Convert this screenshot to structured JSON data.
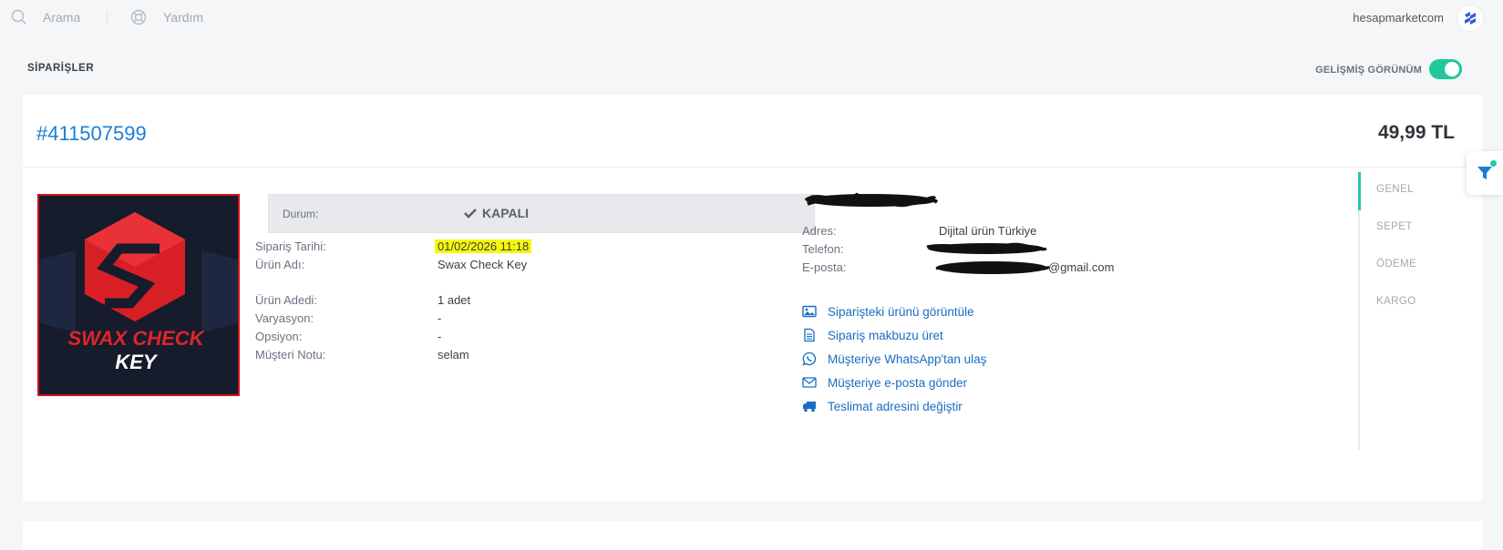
{
  "topbar": {
    "search_label": "Arama",
    "help_label": "Yardım",
    "username": "hesapmarketcom",
    "logo_icon": "store-logo-icon"
  },
  "page": {
    "title": "SİPARİŞLER",
    "advanced_view_label": "GELİŞMİŞ GÖRÜNÜM",
    "advanced_view_on": true
  },
  "order": {
    "number": "#411507599",
    "total": "49,99 TL",
    "product_image_text_line1": "SWAX CHECK",
    "product_image_text_line2": "KEY",
    "status_label": "Durum:",
    "status_value": "KAPALI",
    "fields": [
      {
        "label": "Sipariş Tarihi:",
        "value": "01/02/2026 11:18"
      },
      {
        "label": "Ürün Adı:",
        "value": "Swax Check Key"
      },
      {
        "label": "Ürün Adedi:",
        "value": "1 adet"
      },
      {
        "label": "Varyasyon:",
        "value": "-"
      },
      {
        "label": "Opsiyon:",
        "value": "-"
      },
      {
        "label": "Müşteri Notu:",
        "value": "selam"
      }
    ]
  },
  "customer": {
    "address_label": "Adres:",
    "address_value": "Dijital ürün Türkiye",
    "phone_label": "Telefon:",
    "email_label": "E-posta:",
    "email_visible_suffix": "@gmail.com"
  },
  "actions": [
    {
      "label": "Siparişteki ürünü görüntüle",
      "icon": "image-icon"
    },
    {
      "label": "Sipariş makbuzu üret",
      "icon": "document-icon"
    },
    {
      "label": "Müşteriye WhatsApp'tan ulaş",
      "icon": "whatsapp-icon"
    },
    {
      "label": "Müşteriye e-posta gönder",
      "icon": "envelope-icon"
    },
    {
      "label": "Teslimat adresini değiştir",
      "icon": "truck-icon"
    }
  ],
  "sidenav": {
    "items": [
      "GENEL",
      "SEPET",
      "ÖDEME",
      "KARGO"
    ],
    "active": "GENEL"
  },
  "colors": {
    "accent": "#1a7fd4",
    "toggle": "#22c79a",
    "highlight": "#f7f70a",
    "brand_red": "#d4111b"
  }
}
